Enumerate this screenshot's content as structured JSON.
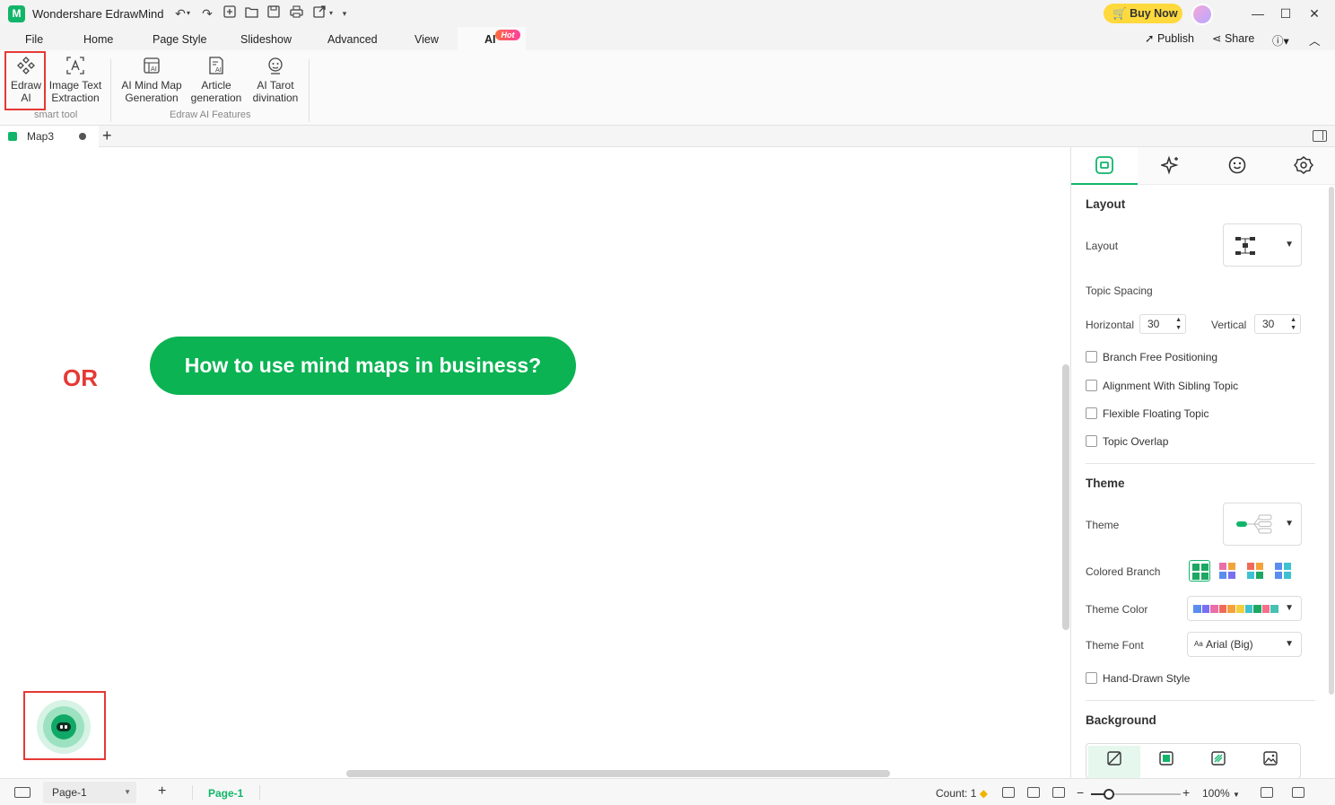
{
  "app": {
    "title": "Wondershare EdrawMind",
    "logo_letter": "M"
  },
  "titlebar": {
    "buy_now": "Buy Now",
    "window_controls": [
      "minimize",
      "maximize",
      "close"
    ]
  },
  "menu": {
    "items": [
      "File",
      "Home",
      "Page Style",
      "Slideshow",
      "Advanced",
      "View"
    ],
    "ai_tab": "AI",
    "hot_badge": "Hot",
    "publish": "Publish",
    "share": "Share"
  },
  "ribbon": {
    "buttons": [
      {
        "line1": "Edraw",
        "line2": "AI",
        "icon": "edraw-ai-icon"
      },
      {
        "line1": "Image Text",
        "line2": "Extraction",
        "icon": "image-text-icon"
      },
      {
        "line1": "AI Mind Map",
        "line2": "Generation",
        "icon": "ai-mindmap-icon"
      },
      {
        "line1": "Article",
        "line2": "generation",
        "icon": "article-icon"
      },
      {
        "line1": "AI Tarot",
        "line2": "divination",
        "icon": "tarot-icon"
      }
    ],
    "groups": [
      "smart tool",
      "Edraw AI Features"
    ]
  },
  "doc_tabs": {
    "active": "Map3"
  },
  "canvas": {
    "or_label": "OR",
    "central_topic": "How to use mind maps in business?"
  },
  "right_panel": {
    "layout_section": "Layout",
    "layout_label": "Layout",
    "topic_spacing": "Topic Spacing",
    "horizontal_label": "Horizontal",
    "horizontal_value": "30",
    "vertical_label": "Vertical",
    "vertical_value": "30",
    "checks": [
      "Branch Free Positioning",
      "Alignment With Sibling Topic",
      "Flexible Floating Topic",
      "Topic Overlap"
    ],
    "theme_section": "Theme",
    "theme_label": "Theme",
    "colored_branch": "Colored Branch",
    "theme_color": "Theme Color",
    "theme_font": "Theme Font",
    "font_value": "Arial (Big)",
    "font_prefix": "Aa",
    "hand_drawn": "Hand-Drawn Style",
    "background_section": "Background",
    "theme_colors": [
      "#5b8def",
      "#7a6ff0",
      "#e96fa8",
      "#f06a5a",
      "#f2a33a",
      "#f4cf3d",
      "#3ec1d3",
      "#1ea763",
      "#f56f8c",
      "#47c1b0"
    ],
    "branch_swatches": [
      [
        "#1ea763",
        "#1ea763",
        "#1ea763",
        "#1ea763"
      ],
      [
        "#e96fa8",
        "#f2a33a",
        "#5b8def",
        "#7a6ff0"
      ],
      [
        "#f06a5a",
        "#f2a33a",
        "#3ec1d3",
        "#1ea763"
      ],
      [
        "#5b8def",
        "#3ec1d3",
        "#5b8def",
        "#3ec1d3"
      ]
    ]
  },
  "statusbar": {
    "page_select": "Page-1",
    "page_tab": "Page-1",
    "count": "Count: 1",
    "zoom": "100%",
    "zoom_level": 0.2
  },
  "colors": {
    "brand_green": "#11b56a",
    "topic_green": "#0bb353",
    "highlight_red": "#e53935",
    "buy_yellow": "#ffd93d"
  }
}
